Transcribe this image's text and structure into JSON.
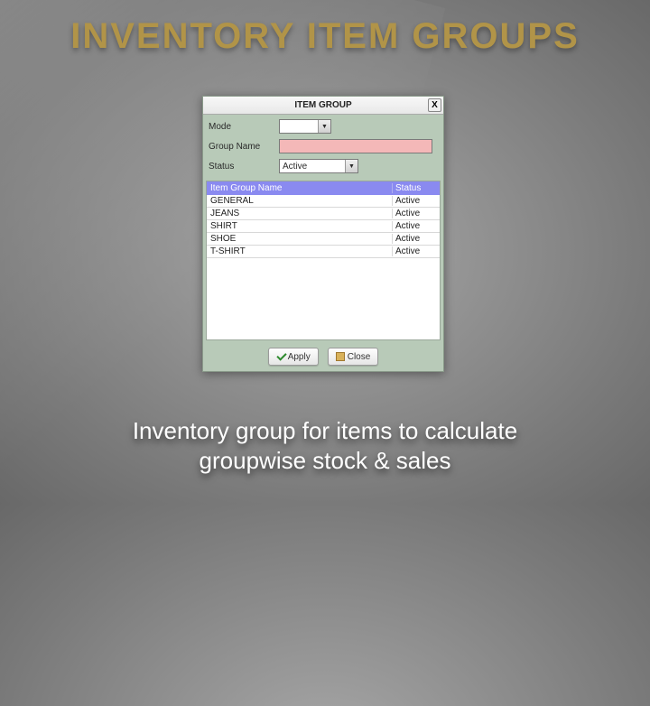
{
  "slide": {
    "title": "INVENTORY ITEM GROUPS",
    "caption_line1": "Inventory  group for items to calculate",
    "caption_line2": "groupwise stock & sales"
  },
  "window": {
    "title": "ITEM GROUP",
    "close_symbol": "X",
    "fields": {
      "mode_label": "Mode",
      "mode_value": "",
      "groupname_label": "Group Name",
      "groupname_value": "",
      "status_label": "Status",
      "status_value": "Active"
    },
    "grid": {
      "header_name": "Item Group Name",
      "header_status": "Status",
      "rows": [
        {
          "name": "GENERAL",
          "status": "Active"
        },
        {
          "name": "JEANS",
          "status": "Active"
        },
        {
          "name": "SHIRT",
          "status": "Active"
        },
        {
          "name": "SHOE",
          "status": "Active"
        },
        {
          "name": "T-SHIRT",
          "status": "Active"
        }
      ]
    },
    "buttons": {
      "apply": "Apply",
      "close": "Close"
    }
  },
  "glyphs": {
    "dropdown": "▼"
  }
}
